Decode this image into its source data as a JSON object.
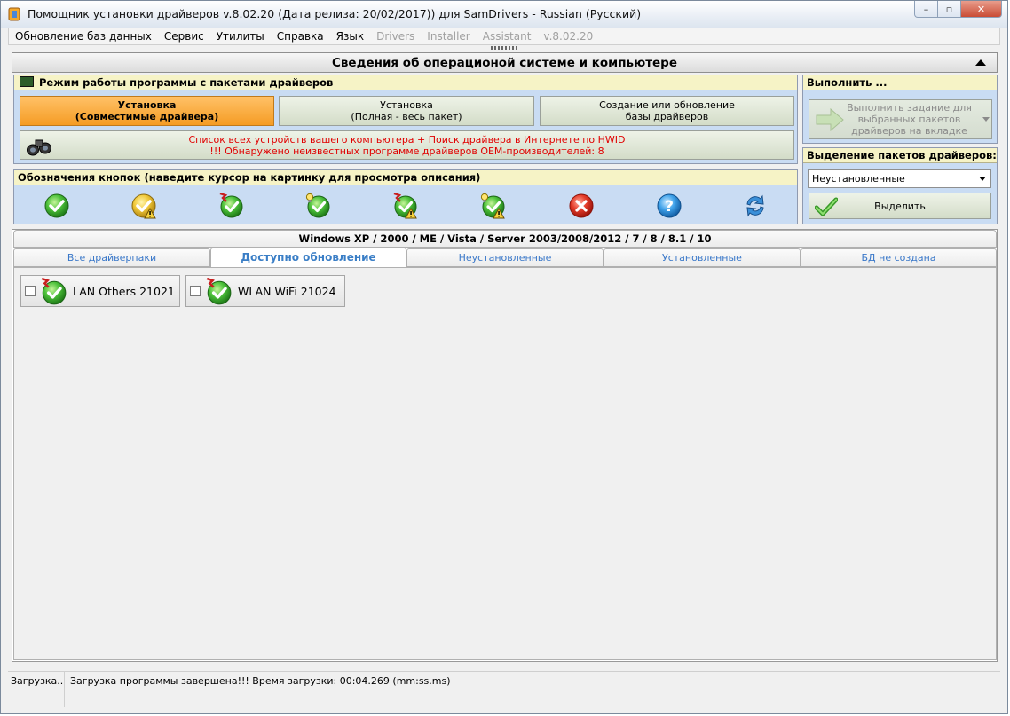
{
  "window": {
    "title": "Помощник установки драйверов v.8.02.20 (Дата релиза: 20/02/2017)) для SamDrivers - Russian (Русский)",
    "controls": {
      "minimize": "–",
      "maximize": "▫",
      "close": "✕"
    }
  },
  "menu": {
    "items": [
      "Обновление баз данных",
      "Сервис",
      "Утилиты",
      "Справка",
      "Язык"
    ],
    "disabled_items": [
      "Drivers",
      "Installer",
      "Assistant",
      "v.8.02.20"
    ]
  },
  "section": {
    "title": "Сведения об операционой системе и компьютере"
  },
  "mode_panel": {
    "title": "Режим работы программы с пакетами драйверов",
    "buttons": [
      {
        "line1": "Установка",
        "line2": "(Совместимые драйвера)",
        "active": true
      },
      {
        "line1": "Установка",
        "line2": "(Полная - весь пакет)",
        "active": false
      },
      {
        "line1": "Создание или обновление",
        "line2": "базы драйверов",
        "active": false
      }
    ],
    "hwid_line1": "Список всех устройств вашего компьютера + Поиск драйвера в Интернете по HWID",
    "hwid_line2": "!!! Обнаружено неизвестных программе драйверов OEM-производителей: 8"
  },
  "legend_panel": {
    "title": "Обозначения кнопок (наведите курсор на картинку для просмотра описания)",
    "icons": [
      "green-check-icon",
      "yellow-check-warning-icon",
      "green-check-flag-icon",
      "green-check-bulb-icon",
      "green-check-flag-warning-icon",
      "green-check-bulb-warning-icon",
      "red-cross-icon",
      "blue-question-icon",
      "refresh-arrows-icon"
    ]
  },
  "execute_panel": {
    "title": "Выполнить ...",
    "line1": "Выполнить задание для",
    "line2": "выбранных пакетов",
    "line3": "драйверов на вкладке"
  },
  "selection_panel": {
    "title": "Выделение пакетов драйверов:",
    "dropdown_value": "Неустановленные",
    "select_button": "Выделить"
  },
  "os_header": "Windows XP / 2000 / ME / Vista / Server 2003/2008/2012 / 7 / 8 / 8.1 / 10",
  "tabs": [
    {
      "label": "Все драйверпаки",
      "active": false
    },
    {
      "label": "Доступно обновление",
      "active": true
    },
    {
      "label": "Неустановленные",
      "active": false
    },
    {
      "label": "Установленные",
      "active": false
    },
    {
      "label": "БД не создана",
      "active": false
    }
  ],
  "packages": [
    {
      "label": "LAN Others 21021",
      "checked": false
    },
    {
      "label": "WLAN WiFi 21024",
      "checked": false
    }
  ],
  "status": {
    "left": "Загрузка...",
    "message": "Загрузка программы завершена!!! Время загрузки: 00:04.269 (mm:ss.ms)"
  },
  "colors": {
    "panel_bg": "#c9dcf3",
    "panel_head_bg": "#f6f3c6",
    "active_button": "#f59c24",
    "tab_text": "#3a78c9",
    "hwid_text": "#e00000"
  }
}
